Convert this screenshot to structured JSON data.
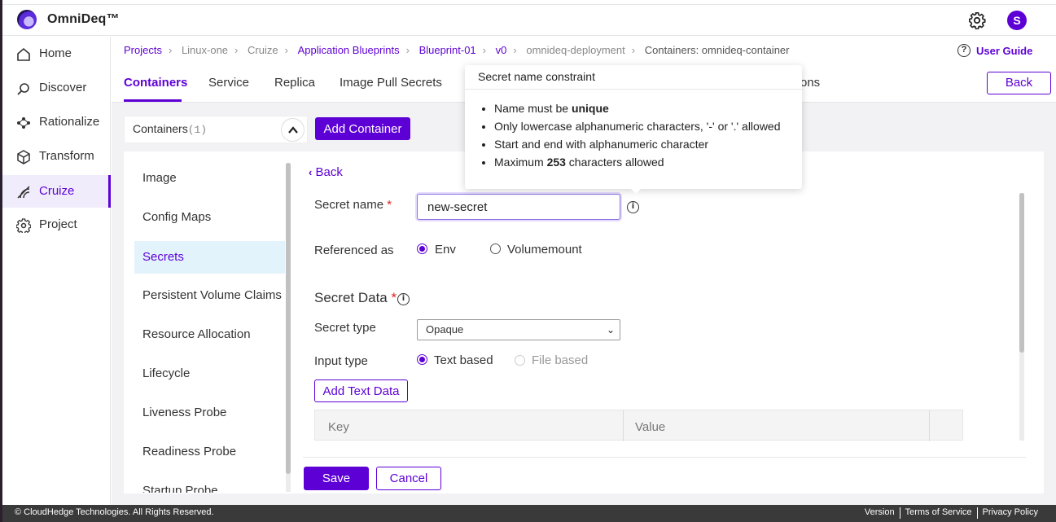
{
  "header": {
    "app_title": "OmniDeq™",
    "user_initial": "S"
  },
  "sidebar": {
    "items": [
      {
        "label": "Home",
        "icon": "home-icon"
      },
      {
        "label": "Discover",
        "icon": "discover-icon"
      },
      {
        "label": "Rationalize",
        "icon": "rationalize-icon"
      },
      {
        "label": "Transform",
        "icon": "cube-icon"
      },
      {
        "label": "Cruize",
        "icon": "cruize-icon",
        "active": true
      },
      {
        "label": "Project",
        "icon": "gear-icon"
      }
    ]
  },
  "breadcrumb": {
    "items": [
      "Projects",
      "Linux-one",
      "Cruize",
      "Application Blueprints",
      "Blueprint-01",
      "v0",
      "omnideq-deployment",
      "Containers: omnideq-container"
    ]
  },
  "user_guide": "User Guide",
  "tabs": {
    "items": [
      "Containers",
      "Service",
      "Replica",
      "Image Pull Secrets"
    ],
    "partial_hidden": "ons",
    "active": "Containers"
  },
  "back_button": "Back",
  "containers_box": {
    "label": "Containers",
    "count": "(1)"
  },
  "add_container": "Add Container",
  "side_list": [
    "Image",
    "Config Maps",
    "Secrets",
    "Persistent Volume Claims",
    "Resource Allocation",
    "Lifecycle",
    "Liveness Probe",
    "Readiness Probe",
    "Startup Probe"
  ],
  "form": {
    "back_link": "Back",
    "secret_name_label": "Secret name",
    "secret_name_value": "new-secret",
    "required_mark": "*",
    "referenced_as_label": "Referenced as",
    "ref_options": [
      "Env",
      "Volumemount"
    ],
    "secret_data_title": "Secret Data",
    "secret_type_label": "Secret type",
    "secret_type_value": "Opaque",
    "input_type_label": "Input type",
    "input_options": [
      "Text based",
      "File based"
    ],
    "add_text_data": "Add Text Data",
    "table_headers": [
      "Key",
      "Value"
    ],
    "save": "Save",
    "cancel": "Cancel"
  },
  "tooltip": {
    "title": "Secret name constraint",
    "lines": [
      {
        "pre": "Name must be ",
        "bold": "unique",
        "post": ""
      },
      {
        "pre": "Only lowercase alphanumeric characters, '-' or '.' allowed",
        "bold": "",
        "post": ""
      },
      {
        "pre": "Start and end with alphanumeric character",
        "bold": "",
        "post": ""
      },
      {
        "pre": "Maximum ",
        "bold": "253",
        "post": " characters allowed"
      }
    ]
  },
  "footer": {
    "copyright": "© CloudHedge Technologies. All Rights Reserved.",
    "links": [
      "Version",
      "Terms of Service",
      "Privacy Policy"
    ]
  },
  "colors": {
    "accent": "#5d00d6",
    "required": "#e02020",
    "footer_bg": "#3a3a3a"
  }
}
